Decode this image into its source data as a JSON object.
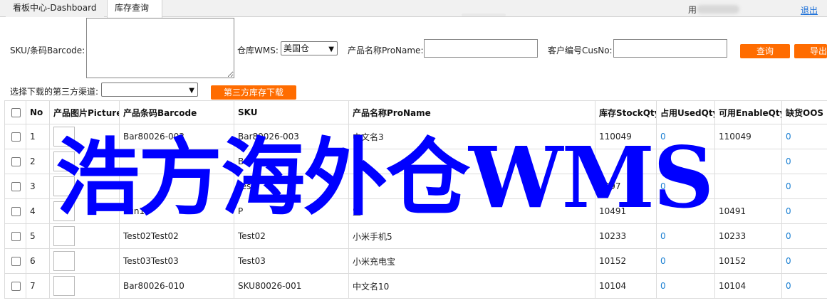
{
  "tabs": [
    {
      "label": "看板中心-Dashboard"
    },
    {
      "label": "库存查询",
      "close": "×"
    }
  ],
  "header": {
    "user_label": "用",
    "logout": "退出"
  },
  "filters": {
    "sku_label": "SKU/条码Barcode:",
    "warehouse_label": "仓库WMS:",
    "warehouse_value": "美国仓",
    "proname_label": "产品名称ProName:",
    "cusno_label": "客户编号CusNo:",
    "query_button": "查询",
    "export_button": "导出",
    "channel_label": "选择下载的第三方渠道:",
    "channel_value": "",
    "download_button": "第三方库存下载"
  },
  "table": {
    "columns": [
      "No",
      "产品图片Picture",
      "产品条码Barcode",
      "SKU",
      "产品名称ProName",
      "库存StockQty",
      "占用UsedQty",
      "可用EnableQty",
      "缺货OOS"
    ],
    "rows": [
      {
        "no": "1",
        "barcode": "Bar80026-003",
        "sku": "Bar80026-003",
        "name": "中文名3",
        "stock": "110049",
        "used": "0",
        "enable": "110049",
        "oos": "0"
      },
      {
        "no": "2",
        "barcode": "",
        "sku": "Ba",
        "name": "",
        "stock": "",
        "used": "",
        "enable": "",
        "oos": "0"
      },
      {
        "no": "3",
        "barcode": "",
        "sku": "tes",
        "name": "",
        "stock": "9997",
        "used": "0",
        "enable": "",
        "oos": "0"
      },
      {
        "no": "4",
        "barcode": "Kun1",
        "sku": "P",
        "name": "宝",
        "stock": "10491",
        "used": "",
        "enable": "10491",
        "oos": "0"
      },
      {
        "no": "5",
        "barcode": "Test02Test02",
        "sku": "Test02",
        "name": "小米手机5",
        "stock": "10233",
        "used": "0",
        "enable": "10233",
        "oos": "0"
      },
      {
        "no": "6",
        "barcode": "Test03Test03",
        "sku": "Test03",
        "name": "小米充电宝",
        "stock": "10152",
        "used": "0",
        "enable": "10152",
        "oos": "0"
      },
      {
        "no": "7",
        "barcode": "Bar80026-010",
        "sku": "SKU80026-001",
        "name": "中文名10",
        "stock": "10104",
        "used": "0",
        "enable": "10104",
        "oos": "0"
      }
    ]
  },
  "watermark": "浩方海外仓WMS",
  "colors": {
    "accent": "#ff6c00",
    "link": "#1a7fd2",
    "watermark": "#0000ff"
  }
}
